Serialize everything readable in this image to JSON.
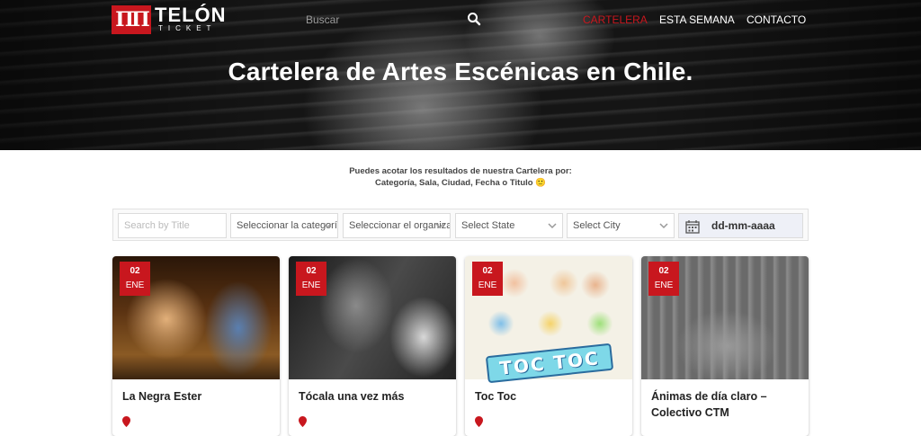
{
  "header": {
    "logo_title": "TELÓN",
    "logo_subtitle": "TICKET",
    "search_placeholder": "Buscar",
    "nav": [
      {
        "label": "CARTELERA",
        "active": true
      },
      {
        "label": "ESTA SEMANA",
        "active": false
      },
      {
        "label": "CONTACTO",
        "active": false
      }
    ]
  },
  "hero": {
    "title": "Cartelera de Artes Escénicas en Chile."
  },
  "intro": {
    "line1": "Puedes acotar los resultados de nuestra Cartelera por:",
    "line2": "Categoría, Sala, Ciudad, Fecha o Titulo 🙂"
  },
  "filters": {
    "title_placeholder": "Search by Title",
    "category": "Seleccionar la categoría",
    "organizer": "Seleccionar el organizador",
    "state": "Select State",
    "city": "Select City",
    "date": "dd-mm-aaaa"
  },
  "cards": [
    {
      "day": "02",
      "month": "ENE",
      "title": "La Negra Ester"
    },
    {
      "day": "02",
      "month": "ENE",
      "title": "Tócala una vez más"
    },
    {
      "day": "02",
      "month": "ENE",
      "title": "Toc Toc",
      "poster_text": "TOC TOC"
    },
    {
      "day": "02",
      "month": "ENE",
      "title": "Ánimas de día claro – Colectivo CTM"
    }
  ],
  "colors": {
    "accent": "#c8171e",
    "text": "#222222"
  }
}
